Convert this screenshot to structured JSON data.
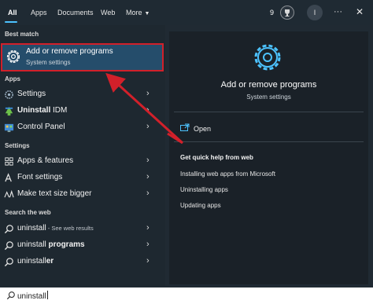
{
  "tabs": [
    {
      "label": "All"
    },
    {
      "label": "Apps"
    },
    {
      "label": "Documents"
    },
    {
      "label": "Web"
    },
    {
      "label": "More"
    }
  ],
  "header": {
    "points": "9",
    "avatar_initial": "I",
    "more_icon": "ellipsis-icon",
    "close_icon": "close-icon"
  },
  "sections": {
    "best_match": "Best match",
    "apps": "Apps",
    "settings": "Settings",
    "web": "Search the web"
  },
  "best_match": {
    "title": "Add or remove programs",
    "subtitle": "System settings",
    "icon": "gear-icon"
  },
  "apps": [
    {
      "label": "Settings",
      "icon": "gear-icon"
    },
    {
      "bold": "Uninstall",
      "rest": " IDM",
      "icon": "idm-icon"
    },
    {
      "label": "Control Panel",
      "icon": "control-panel-icon"
    }
  ],
  "settings": [
    {
      "label": "Apps & features",
      "icon": "apps-features-icon"
    },
    {
      "label": "Font settings",
      "icon": "font-icon"
    },
    {
      "label": "Make text size bigger",
      "icon": "text-size-icon"
    }
  ],
  "web": [
    {
      "main": "uninstall",
      "small": " - See web results"
    },
    {
      "main": "uninstall ",
      "bold": "programs"
    },
    {
      "main": "uninstall",
      "bold": "er"
    }
  ],
  "preview": {
    "title": "Add or remove programs",
    "subtitle": "System settings",
    "open_label": "Open",
    "help_title": "Get quick help from web",
    "help_links": [
      "Installing web apps from Microsoft",
      "Uninstalling apps",
      "Updating apps"
    ]
  },
  "search": {
    "value": "uninstall",
    "icon": "search-icon"
  },
  "colors": {
    "accent": "#4cc2ff",
    "highlight_border": "#d2202a",
    "annotation_arrow": "#d2202a"
  }
}
